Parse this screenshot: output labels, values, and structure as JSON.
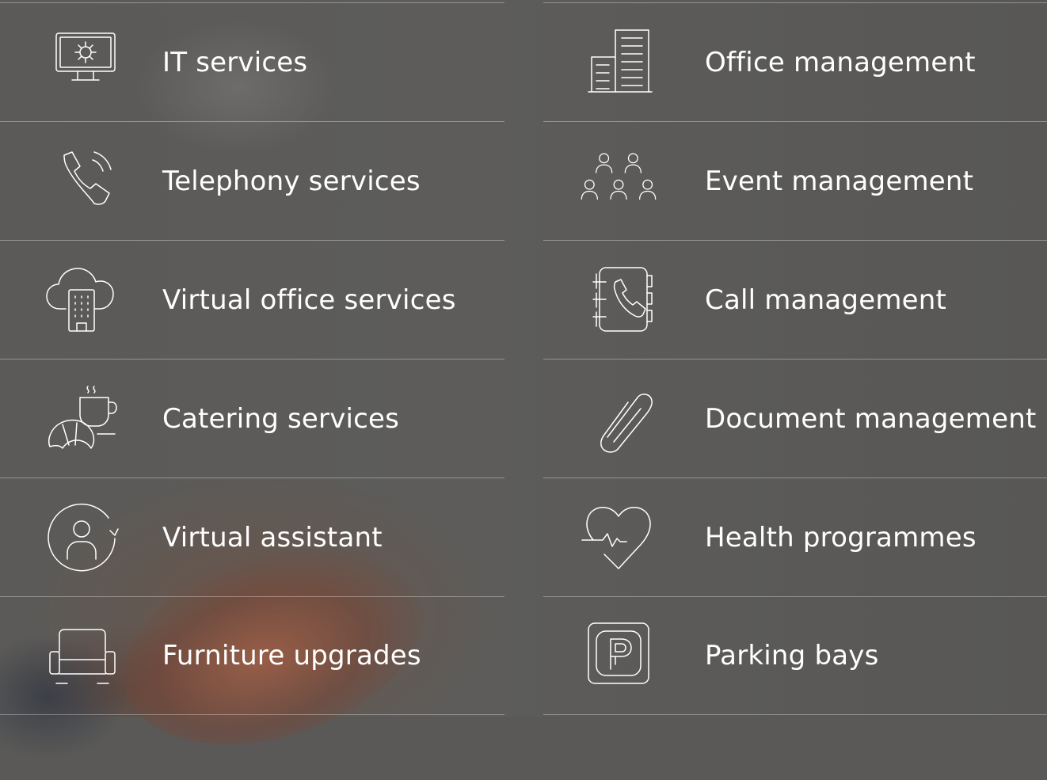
{
  "services": {
    "left": [
      {
        "label": "IT services",
        "icon": "monitor-gear-icon"
      },
      {
        "label": "Telephony services",
        "icon": "phone-ringing-icon"
      },
      {
        "label": "Virtual office services",
        "icon": "cloud-building-icon"
      },
      {
        "label": "Catering services",
        "icon": "coffee-croissant-icon"
      },
      {
        "label": "Virtual assistant",
        "icon": "user-refresh-icon"
      },
      {
        "label": "Furniture upgrades",
        "icon": "armchair-icon"
      }
    ],
    "right": [
      {
        "label": "Office management",
        "icon": "office-buildings-icon"
      },
      {
        "label": "Event management",
        "icon": "group-people-icon"
      },
      {
        "label": "Call management",
        "icon": "phone-book-icon"
      },
      {
        "label": "Document management",
        "icon": "paperclip-icon"
      },
      {
        "label": "Health programmes",
        "icon": "heart-pulse-icon"
      },
      {
        "label": "Parking bays",
        "icon": "parking-sign-icon"
      }
    ]
  },
  "colors": {
    "text": "#ffffff",
    "divider": "rgba(255,255,255,0.35)",
    "background": "#5a5957"
  }
}
